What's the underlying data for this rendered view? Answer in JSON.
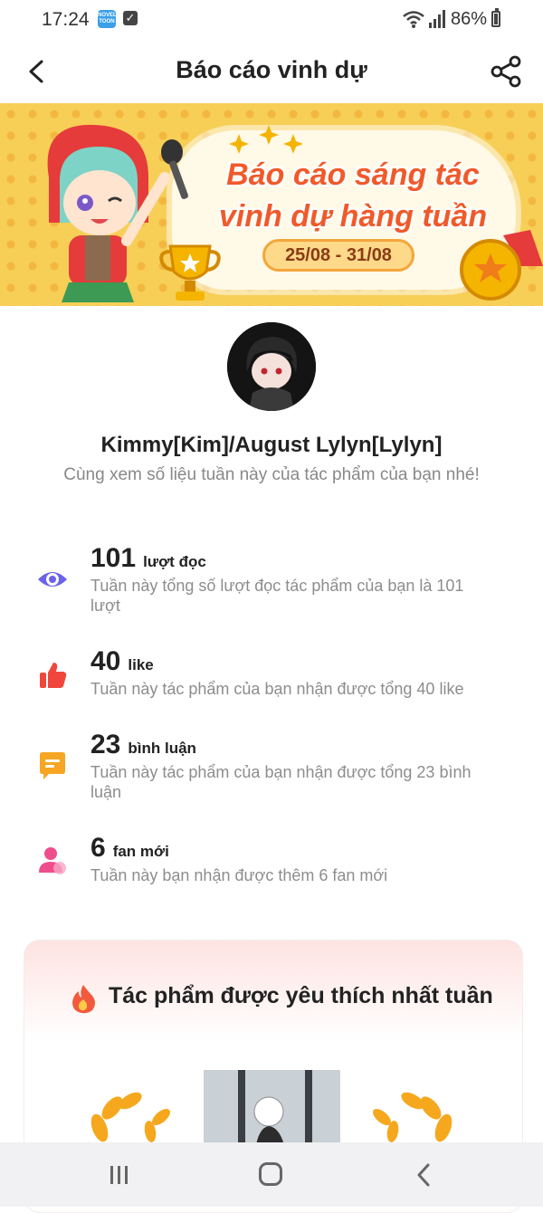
{
  "status_bar": {
    "time": "17:24",
    "app_badge": "NOVEL TOON",
    "battery": "86%",
    "icons": [
      "notification-app-icon",
      "task-check-icon",
      "wifi-icon",
      "signal-icon",
      "battery-icon"
    ]
  },
  "header": {
    "title": "Báo cáo vinh dự",
    "back_icon": "chevron-left-icon",
    "share_icon": "share-icon"
  },
  "banner": {
    "title_line1": "Báo cáo sáng tác",
    "title_line2": "vinh dự hàng tuần",
    "date_range": "25/08 - 31/08"
  },
  "profile": {
    "name": "Kimmy[Kim]/August Lylyn[Lylyn]",
    "subtitle": "Cùng xem số liệu tuần này của tác phẩm của bạn nhé!"
  },
  "stats": [
    {
      "icon": "eye-icon",
      "value": "101",
      "unit": "lượt đọc",
      "description": "Tuần này tổng số lượt đọc tác phẩm của bạn là 101 lượt",
      "color": "#6c63e8"
    },
    {
      "icon": "thumbs-up-icon",
      "value": "40",
      "unit": "like",
      "description": "Tuần này tác phẩm của bạn nhận được tổng 40 like",
      "color": "#f0463c"
    },
    {
      "icon": "comment-icon",
      "value": "23",
      "unit": "bình luận",
      "description": "Tuần này tác phẩm của bạn nhận được tổng 23 bình luận",
      "color": "#f6a623"
    },
    {
      "icon": "user-icon",
      "value": "6",
      "unit": "fan mới",
      "description": "Tuần này bạn nhận được thêm 6 fan mới",
      "color": "#ef4e8e"
    }
  ],
  "favorite": {
    "title": "Tác phẩm được yêu thích nhất tuần",
    "icon": "fire-icon"
  },
  "nav_bar": {
    "icons": [
      "recent-apps-icon",
      "home-icon",
      "back-icon"
    ]
  }
}
